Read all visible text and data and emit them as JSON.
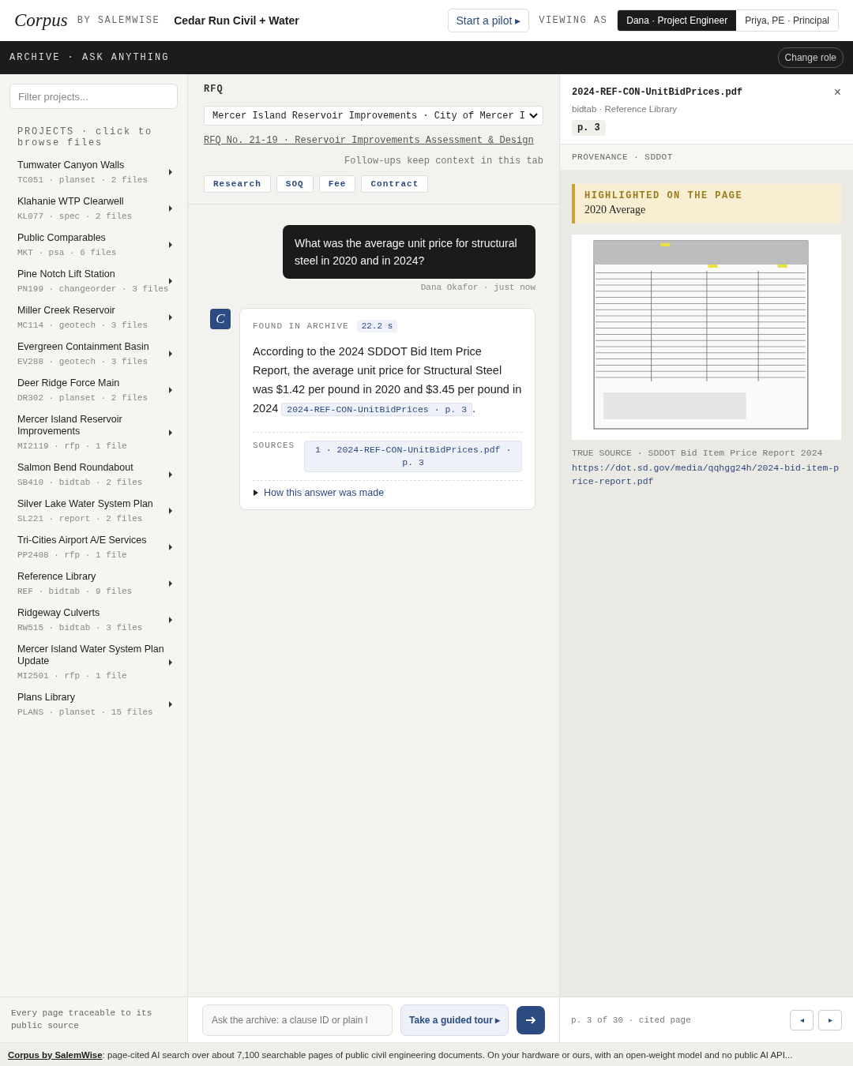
{
  "header": {
    "logo": "Corpus",
    "by": "BY SALEMWISE",
    "org": "Cedar Run Civil + Water",
    "pilot_button": "Start a pilot ▸",
    "viewing_label": "VIEWING AS",
    "roles": [
      {
        "label": "Dana · Project Engineer",
        "selected": true
      },
      {
        "label": "Priya, PE · Principal",
        "selected": false
      }
    ]
  },
  "subbar": {
    "title": "ARCHIVE · ASK ANYTHING",
    "role_button": "Change role"
  },
  "sidebar": {
    "filter_placeholder": "Filter projects...",
    "heading": "PROJECTS · click to browse files",
    "projects": [
      {
        "name": "Tumwater Canyon Walls",
        "meta": "TC051 · planset · 2 files"
      },
      {
        "name": "Klahanie WTP Clearwell",
        "meta": "KL077 · spec · 2 files"
      },
      {
        "name": "Public Comparables",
        "meta": "MKT · psa · 6 files"
      },
      {
        "name": "Pine Notch Lift Station",
        "meta": "PN199 · changeorder · 3 files"
      },
      {
        "name": "Miller Creek Reservoir",
        "meta": "MC114 · geotech · 3 files"
      },
      {
        "name": "Evergreen Containment Basin",
        "meta": "EV288 · geotech · 3 files"
      },
      {
        "name": "Deer Ridge Force Main",
        "meta": "DR302 · planset · 2 files"
      },
      {
        "name": "Mercer Island Reservoir Improvements",
        "meta": "MI2119 · rfp · 1 file"
      },
      {
        "name": "Salmon Bend Roundabout",
        "meta": "SB410 · bidtab · 2 files"
      },
      {
        "name": "Silver Lake Water System Plan",
        "meta": "SL221 · report · 2 files"
      },
      {
        "name": "Tri-Cities Airport A/E Services",
        "meta": "PP2408 · rfp · 1 file"
      },
      {
        "name": "Reference Library",
        "meta": "REF · bidtab · 9 files"
      },
      {
        "name": "Ridgeway Culverts",
        "meta": "RW515 · bidtab · 3 files"
      },
      {
        "name": "Mercer Island Water System Plan Update",
        "meta": "MI2501 · rfp · 1 file"
      },
      {
        "name": "Plans Library",
        "meta": "PLANS · planset · 15 files"
      }
    ],
    "footer": "Every page traceable to its public source"
  },
  "center": {
    "label": "RFQ",
    "select_value": "Mercer Island Reservoir Improvements · City of Mercer I",
    "rfq_link": "RFQ No. 21-19 · Reservoir Improvements Assessment & Design",
    "followup_note": "Follow-ups keep context in this tab",
    "modes": [
      "Research",
      "SOQ",
      "Fee",
      "Contract"
    ],
    "question": {
      "text": "What was the average unit price for structural steel in 2020 and in 2024?",
      "author": "Dana Okafor · just now"
    },
    "answer": {
      "avatar": "C",
      "found_label": "FOUND IN ARCHIVE",
      "time": "22.2 s",
      "text": "According to the 2024 SDDOT Bid Item Price Report, the average unit price for Structural Steel was $1.42 per pound in 2020 and $3.45 per pound in 2024",
      "citation": "2024-REF-CON-UnitBidPrices · p. 3",
      "end": ".",
      "sources_label": "SOURCES",
      "sources": [
        "1 · 2024-REF-CON-UnitBidPrices.pdf · p. 3"
      ],
      "how": "How this answer was made",
      "expanded": false
    },
    "ask_placeholder": "Ask the archive: a clause ID or plain l",
    "tour_button": "Take a guided tour ▸"
  },
  "viewer": {
    "filename": "2024-REF-CON-UnitBidPrices.pdf",
    "close": "×",
    "subtitle": "bidtab · Reference Library",
    "page_badge": "p. 3",
    "provenance": "PROVENANCE · SDDOT",
    "highlight_label": "HIGHLIGHTED ON THE PAGE",
    "highlight_text": "2020 Average",
    "true_source": "TRUE SOURCE · SDDOT Bid Item Price Report 2024",
    "url": "https://dot.sd.gov/media/qqhgg24h/2024-bid-item-price-report.pdf",
    "page_status": "p. 3 of 30 · cited page",
    "prev": "◂",
    "next": "▸"
  },
  "footer": {
    "brand": "Corpus by SalemWise",
    "text": ": page-cited AI search over about 7,100 searchable pages of public civil engineering documents. On your hardware or ours, with an open-weight model and no public AI API..."
  }
}
